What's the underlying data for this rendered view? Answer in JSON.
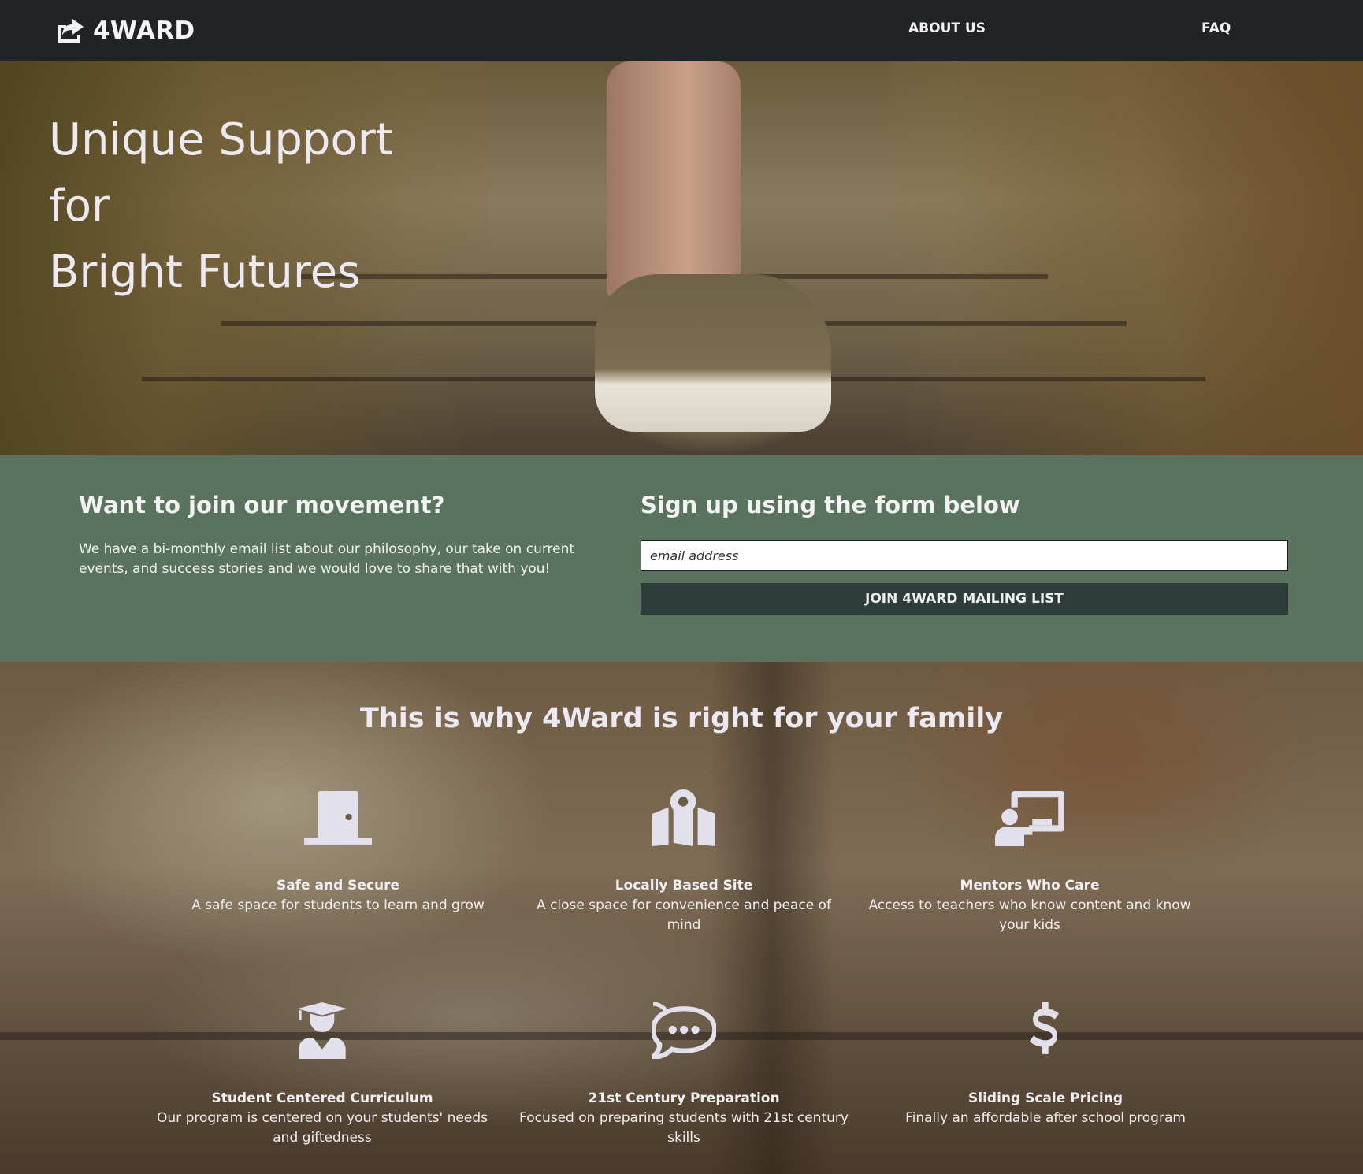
{
  "nav": {
    "brand": "4WARD",
    "brand_icon": "share-square-icon",
    "links": [
      {
        "label": "ABOUT US"
      },
      {
        "label": "FAQ"
      }
    ]
  },
  "hero": {
    "title_lines": [
      "Unique Support",
      "for",
      "Bright Futures"
    ]
  },
  "signup": {
    "left_title": "Want to join our movement?",
    "left_text": "We have a bi-monthly email list about our philosophy, our take on current events, and success stories and we would love to share that with you!",
    "right_title": "Sign up using the form below",
    "email_placeholder": "email address",
    "email_value": "",
    "button_label": "JOIN 4WARD MAILING LIST",
    "bg_color": "#5a735e",
    "button_color": "#2e3d3b"
  },
  "features": {
    "title": "This is why 4Ward is right for your family",
    "items": [
      {
        "icon": "door-icon",
        "title": "Safe and Secure",
        "description": "A safe space for students to learn and grow"
      },
      {
        "icon": "map-location-icon",
        "title": "Locally Based Site",
        "description": "A close space for convenience and peace of mind"
      },
      {
        "icon": "teacher-board-icon",
        "title": "Mentors Who Care",
        "description": "Access to teachers who know content and know your kids"
      },
      {
        "icon": "graduate-icon",
        "title": "Student Centered Curriculum",
        "description": "Our program is centered on your students' needs and giftedness"
      },
      {
        "icon": "rocketchat-icon",
        "title": "21st Century Preparation",
        "description": "Focused on preparing students with 21st century skills"
      },
      {
        "icon": "dollar-icon",
        "title": "Sliding Scale Pricing",
        "description": "Finally an affordable after school program"
      }
    ]
  }
}
